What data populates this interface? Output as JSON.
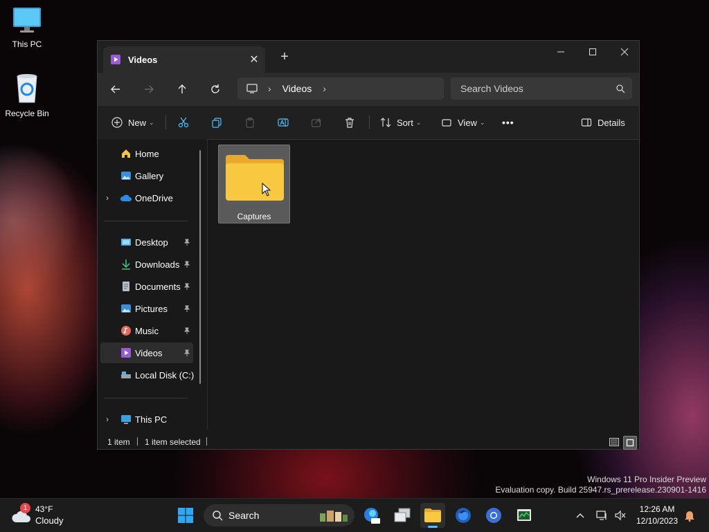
{
  "desktop": {
    "icons": [
      {
        "label": "This PC",
        "icon": "monitor-icon"
      },
      {
        "label": "Recycle Bin",
        "icon": "recycle-bin-icon"
      }
    ]
  },
  "window": {
    "tab_title": "Videos",
    "new_tab_symbol": "+",
    "address": {
      "segment": "Videos"
    },
    "search_placeholder": "Search Videos",
    "toolbar": {
      "new_label": "New",
      "sort_label": "Sort",
      "view_label": "View",
      "more_label": "•••",
      "details_label": "Details"
    },
    "nav": {
      "home": "Home",
      "gallery": "Gallery",
      "onedrive": "OneDrive",
      "desktop": "Desktop",
      "downloads": "Downloads",
      "documents": "Documents",
      "pictures": "Pictures",
      "music": "Music",
      "videos": "Videos",
      "local_disk": "Local Disk (C:)",
      "this_pc": "This PC"
    },
    "items": [
      {
        "name": "Captures",
        "type": "folder",
        "selected": true
      }
    ],
    "status": {
      "count": "1 item",
      "selected": "1 item selected"
    }
  },
  "watermark": {
    "line1": "Windows 11 Pro Insider Preview",
    "line2": "Evaluation copy. Build 25947.rs_prerelease.230901-1416"
  },
  "taskbar": {
    "weather": {
      "temp": "43°F",
      "condition": "Cloudy",
      "badge": "1"
    },
    "search_label": "Search",
    "clock": {
      "time": "12:26 AM",
      "date": "12/10/2023"
    }
  },
  "colors": {
    "accent": "#4cc2ff",
    "folder": "#f8c940",
    "window_bg": "#191919",
    "selection": "#5a5a5a"
  }
}
